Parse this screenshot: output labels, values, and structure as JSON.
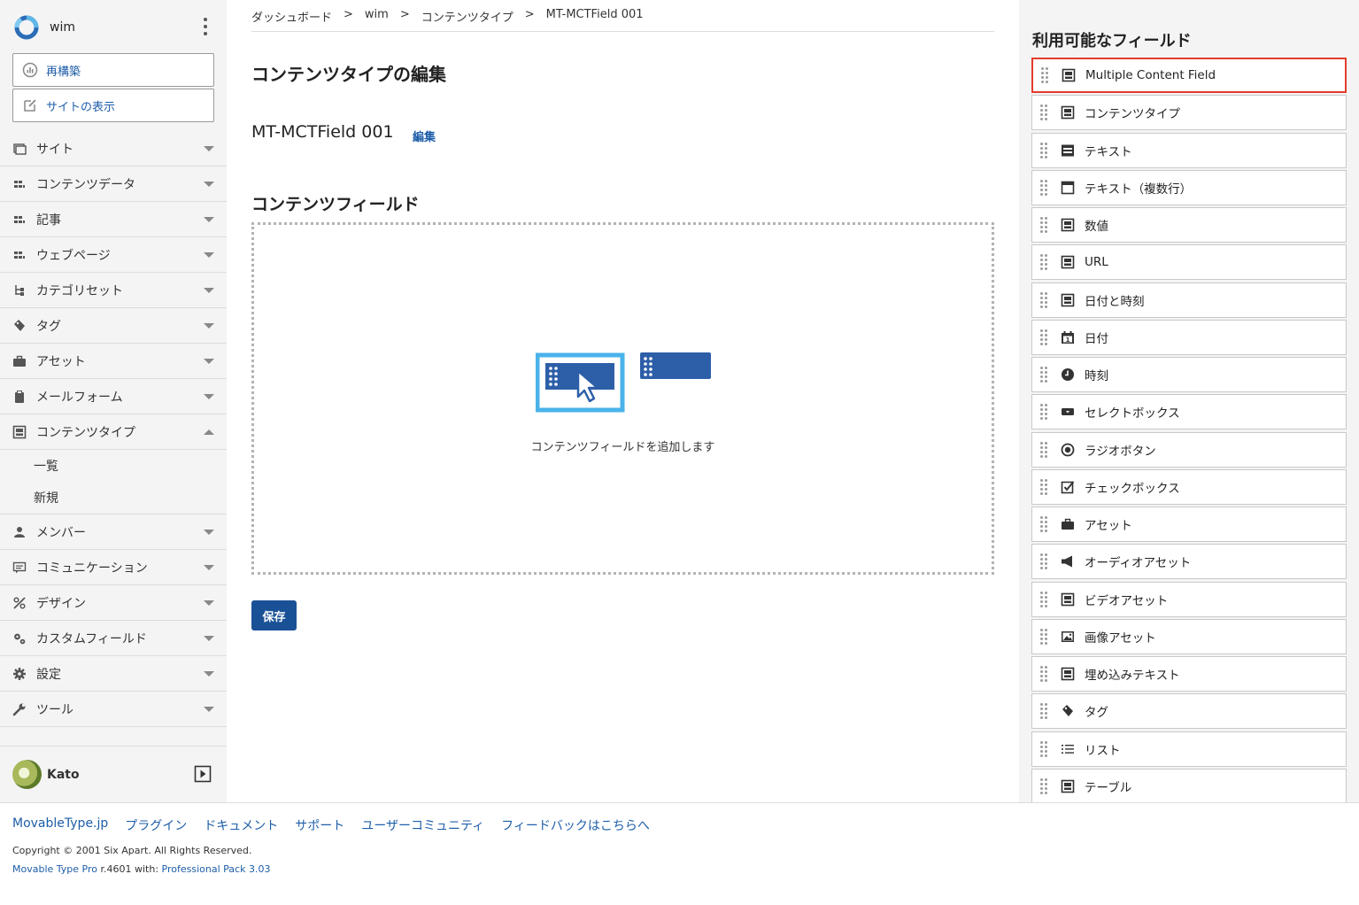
{
  "brand": {
    "site_name": "wim"
  },
  "actions": {
    "rebuild": "再構築",
    "view_site": "サイトの表示"
  },
  "nav": {
    "items": [
      {
        "label": "サイト",
        "icon": "window-icon"
      },
      {
        "label": "コンテンツデータ",
        "icon": "content-data-icon"
      },
      {
        "label": "記事",
        "icon": "entry-icon"
      },
      {
        "label": "ウェブページ",
        "icon": "page-icon"
      },
      {
        "label": "カテゴリセット",
        "icon": "tree-icon"
      },
      {
        "label": "タグ",
        "icon": "tag-icon"
      },
      {
        "label": "アセット",
        "icon": "briefcase-icon"
      },
      {
        "label": "メールフォーム",
        "icon": "clipboard-icon"
      },
      {
        "label": "コンテンツタイプ",
        "icon": "content-type-icon"
      },
      {
        "label": "メンバー",
        "icon": "user-icon"
      },
      {
        "label": "コミュニケーション",
        "icon": "comment-icon"
      },
      {
        "label": "デザイン",
        "icon": "design-icon"
      },
      {
        "label": "カスタムフィールド",
        "icon": "gears-icon"
      },
      {
        "label": "設定",
        "icon": "gear-icon"
      },
      {
        "label": "ツール",
        "icon": "wrench-icon"
      }
    ],
    "content_type_sub": {
      "list": "一覧",
      "new": "新規"
    }
  },
  "user": {
    "name": "Kato"
  },
  "breadcrumb": [
    "ダッシュボード",
    "wim",
    "コンテンツタイプ",
    "MT-MCTField 001"
  ],
  "breadcrumb_sep": ">",
  "main": {
    "page_title": "コンテンツタイプの編集",
    "content_type_name": "MT-MCTField 001",
    "edit_link": "編集",
    "section_title": "コンテンツフィールド",
    "drop_text": "コンテンツフィールドを追加します",
    "save_button": "保存"
  },
  "right": {
    "title": "利用可能なフィールド",
    "fields": [
      {
        "label": "Multiple Content Field",
        "icon": "content-field-icon",
        "highlighted": true
      },
      {
        "label": "コンテンツタイプ",
        "icon": "content-field-icon"
      },
      {
        "label": "テキスト",
        "icon": "text-icon"
      },
      {
        "label": "テキスト（複数行）",
        "icon": "textarea-icon"
      },
      {
        "label": "数値",
        "icon": "content-field-icon"
      },
      {
        "label": "URL",
        "icon": "content-field-icon"
      },
      {
        "label": "日付と時刻",
        "icon": "content-field-icon"
      },
      {
        "label": "日付",
        "icon": "calendar-icon"
      },
      {
        "label": "時刻",
        "icon": "clock-icon"
      },
      {
        "label": "セレクトボックス",
        "icon": "select-icon"
      },
      {
        "label": "ラジオボタン",
        "icon": "radio-icon"
      },
      {
        "label": "チェックボックス",
        "icon": "checkbox-icon"
      },
      {
        "label": "アセット",
        "icon": "briefcase-icon"
      },
      {
        "label": "オーディオアセット",
        "icon": "speaker-icon"
      },
      {
        "label": "ビデオアセット",
        "icon": "content-field-icon"
      },
      {
        "label": "画像アセット",
        "icon": "image-icon"
      },
      {
        "label": "埋め込みテキスト",
        "icon": "content-field-icon"
      },
      {
        "label": "タグ",
        "icon": "tag-icon"
      },
      {
        "label": "リスト",
        "icon": "list-icon"
      },
      {
        "label": "テーブル",
        "icon": "content-field-icon"
      }
    ]
  },
  "footer": {
    "links": [
      "MovableType.jp",
      "プラグイン",
      "ドキュメント",
      "サポート",
      "ユーザーコミュニティ",
      "フィードバックはこちらへ"
    ],
    "copyright": "Copyright © 2001 Six Apart. All Rights Reserved.",
    "version_product": "Movable Type Pro",
    "version_rev": " r.4601 with: ",
    "version_pack": "Professional Pack 3.03"
  },
  "colors": {
    "link": "#1e5ea8",
    "primary_button": "#1a5196",
    "highlight_border": "#e43b2b",
    "illustration_blue": "#2d5fa8",
    "illustration_frame": "#4ab3ea"
  }
}
